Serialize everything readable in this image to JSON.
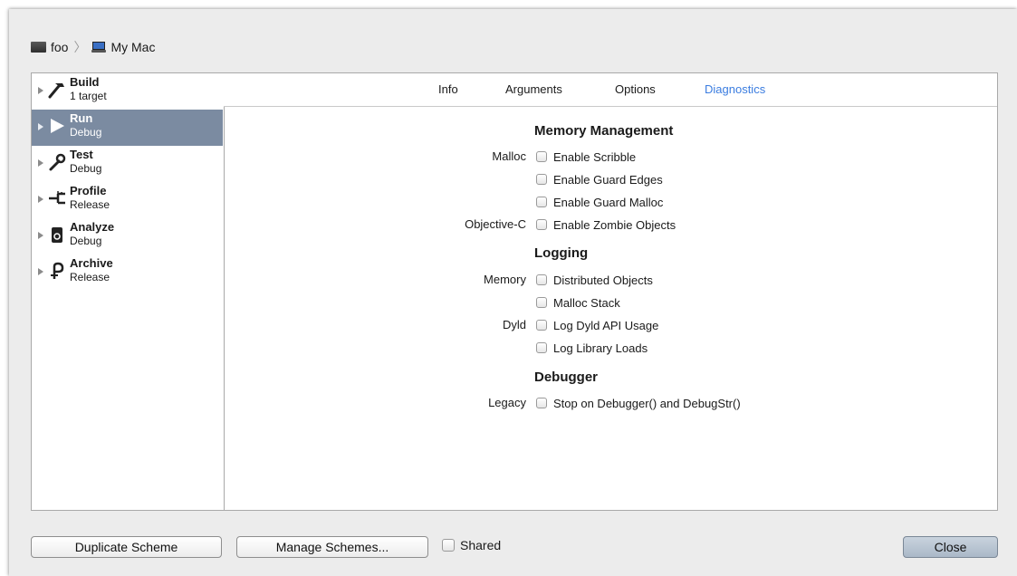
{
  "breadcrumb": {
    "project": "foo",
    "destination": "My Mac"
  },
  "actions": [
    {
      "name": "Build",
      "sub": "1 target",
      "icon": "hammer-icon",
      "selected": false
    },
    {
      "name": "Run",
      "sub": "Debug",
      "icon": "play-icon",
      "selected": true
    },
    {
      "name": "Test",
      "sub": "Debug",
      "icon": "wrench-icon",
      "selected": false
    },
    {
      "name": "Profile",
      "sub": "Release",
      "icon": "tuning-fork-icon",
      "selected": false
    },
    {
      "name": "Analyze",
      "sub": "Debug",
      "icon": "analyze-icon",
      "selected": false
    },
    {
      "name": "Archive",
      "sub": "Release",
      "icon": "archive-icon",
      "selected": false
    }
  ],
  "tabs": [
    {
      "label": "Info",
      "active": false
    },
    {
      "label": "Arguments",
      "active": false
    },
    {
      "label": "Options",
      "active": false
    },
    {
      "label": "Diagnostics",
      "active": true
    }
  ],
  "diagnostics": {
    "memory_management": {
      "title": "Memory Management",
      "malloc_label": "Malloc",
      "objc_label": "Objective-C",
      "options": [
        "Enable Scribble",
        "Enable Guard Edges",
        "Enable Guard Malloc",
        "Enable Zombie Objects"
      ]
    },
    "logging": {
      "title": "Logging",
      "memory_label": "Memory",
      "dyld_label": "Dyld",
      "options": [
        "Distributed Objects",
        "Malloc Stack",
        "Log Dyld API Usage",
        "Log Library Loads"
      ]
    },
    "debugger": {
      "title": "Debugger",
      "legacy_label": "Legacy",
      "options": [
        "Stop on Debugger() and DebugStr()"
      ]
    }
  },
  "footer": {
    "duplicate_label": "Duplicate Scheme",
    "manage_label": "Manage Schemes...",
    "shared_label": "Shared",
    "close_label": "Close"
  },
  "colors": {
    "selection": "#7b8ba1",
    "active_tab": "#3b7de0"
  }
}
